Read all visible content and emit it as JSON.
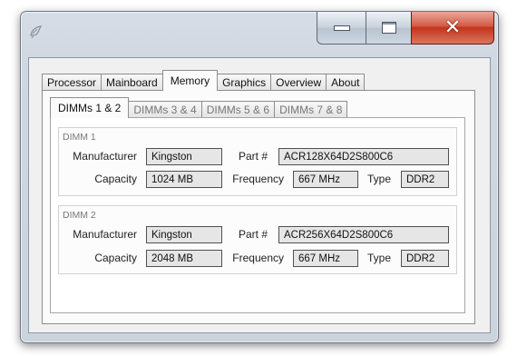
{
  "window": {
    "buttons": {
      "minimize_icon": "minimize-icon",
      "maximize_icon": "maximize-icon",
      "close_glyph": "✕"
    }
  },
  "main_tabs": [
    "Processor",
    "Mainboard",
    "Memory",
    "Graphics",
    "Overview",
    "About"
  ],
  "active_main_tab": "Memory",
  "sub_tabs": [
    "DIMMs 1 & 2",
    "DIMMs 3 & 4",
    "DIMMs 5 & 6",
    "DIMMs 7 & 8"
  ],
  "active_sub_tab": "DIMMs 1 & 2",
  "labels": {
    "manufacturer": "Manufacturer",
    "part": "Part #",
    "capacity": "Capacity",
    "frequency": "Frequency",
    "type": "Type"
  },
  "dimms": [
    {
      "title": "DIMM 1",
      "manufacturer": "Kingston",
      "part": "ACR128X64D2S800C6",
      "capacity": "1024 MB",
      "frequency": "667 MHz",
      "type": "DDR2"
    },
    {
      "title": "DIMM 2",
      "manufacturer": "Kingston",
      "part": "ACR256X64D2S800C6",
      "capacity": "2048 MB",
      "frequency": "667 MHz",
      "type": "DDR2"
    }
  ]
}
